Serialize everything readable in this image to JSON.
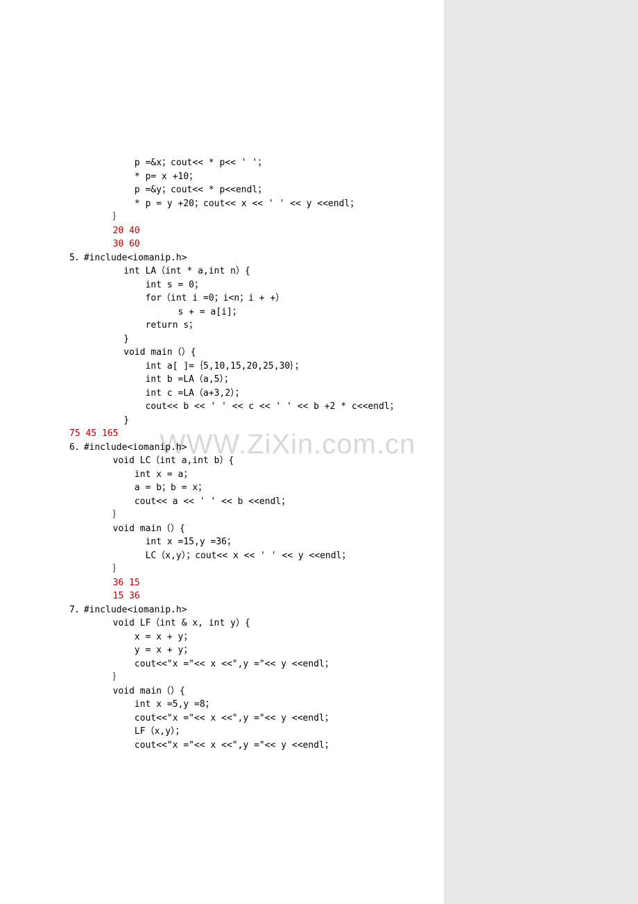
{
  "watermark": "WWW.ZiXin.com.cn",
  "lines": [
    {
      "indent": 3,
      "text": "p =&x；cout<< * p<< ' '；",
      "class": ""
    },
    {
      "indent": 3,
      "text": "* p= x +10；",
      "class": ""
    },
    {
      "indent": 3,
      "text": "p =&y；cout<< * p<<endl；",
      "class": ""
    },
    {
      "indent": 3,
      "text": "* p = y +20；cout<< x << ' ' << y <<endl；",
      "class": ""
    },
    {
      "indent": 2,
      "text": "｝",
      "class": ""
    },
    {
      "indent": 2,
      "text": "20 40",
      "class": "red"
    },
    {
      "indent": 2,
      "text": "30 60",
      "class": "red"
    },
    {
      "indent": 0,
      "text": "5．#include<iomanip.h>",
      "class": ""
    },
    {
      "indent": 2.5,
      "text": "int LA（int * a,int n）{",
      "class": ""
    },
    {
      "indent": 3.5,
      "text": "int s = 0；",
      "class": ""
    },
    {
      "indent": 3.5,
      "text": "for（int i =0；i<n；i + +）",
      "class": ""
    },
    {
      "indent": 5,
      "text": "s + = a[i]；",
      "class": ""
    },
    {
      "indent": 3.5,
      "text": "return s；",
      "class": ""
    },
    {
      "indent": 2.5,
      "text": "}",
      "class": ""
    },
    {
      "indent": 2.5,
      "text": "void main（）{",
      "class": ""
    },
    {
      "indent": 3.5,
      "text": "int a[ ]=｛5,10,15,20,25,30｝；",
      "class": ""
    },
    {
      "indent": 3.5,
      "text": "int b =LA（a,5）；",
      "class": ""
    },
    {
      "indent": 3.5,
      "text": "int c =LA（a+3,2）；",
      "class": ""
    },
    {
      "indent": 3.5,
      "text": "cout<< b << ' ' << c << ' ' << b +2 * c<<endl；",
      "class": ""
    },
    {
      "indent": 2.5,
      "text": "}",
      "class": ""
    },
    {
      "indent": -0.5,
      "text": "75 45 165",
      "class": "red"
    },
    {
      "indent": 0,
      "text": "6．#include<iomanip.h>",
      "class": ""
    },
    {
      "indent": 2,
      "text": "void LC（int a,int b）{",
      "class": ""
    },
    {
      "indent": 3,
      "text": "int x = a；",
      "class": ""
    },
    {
      "indent": 3,
      "text": "a = b；b = x；",
      "class": ""
    },
    {
      "indent": 3,
      "text": "cout<< a << ' ' << b <<endl；",
      "class": ""
    },
    {
      "indent": 2,
      "text": "｝",
      "class": ""
    },
    {
      "indent": 2,
      "text": "void main（）{",
      "class": ""
    },
    {
      "indent": 3.5,
      "text": "int x =15,y =36；",
      "class": ""
    },
    {
      "indent": 3.5,
      "text": "LC（x,y）；cout<< x << ' ' << y <<endl；",
      "class": ""
    },
    {
      "indent": 2,
      "text": "｝",
      "class": ""
    },
    {
      "indent": 2,
      "text": "36 15",
      "class": "red"
    },
    {
      "indent": 2,
      "text": "15 36",
      "class": "red"
    },
    {
      "indent": 0,
      "text": "7．#include<iomanip.h>",
      "class": ""
    },
    {
      "indent": 2,
      "text": "void LF（int & x, int y）{",
      "class": ""
    },
    {
      "indent": 3,
      "text": "x = x + y；",
      "class": ""
    },
    {
      "indent": 3,
      "text": "y = x + y；",
      "class": ""
    },
    {
      "indent": 3,
      "text": "cout<<\"x =\"<< x <<\",y =\"<< y <<endl；",
      "class": ""
    },
    {
      "indent": 2,
      "text": "｝",
      "class": ""
    },
    {
      "indent": 2,
      "text": "void main（）{",
      "class": ""
    },
    {
      "indent": 3,
      "text": "int x =5,y =8；",
      "class": ""
    },
    {
      "indent": 3,
      "text": "cout<<\"x =\"<< x <<\",y =\"<< y <<endl；",
      "class": ""
    },
    {
      "indent": 3,
      "text": "LF（x,y）；",
      "class": ""
    },
    {
      "indent": 3,
      "text": "cout<<\"x =\"<< x <<\",y =\"<< y <<endl；",
      "class": ""
    }
  ]
}
